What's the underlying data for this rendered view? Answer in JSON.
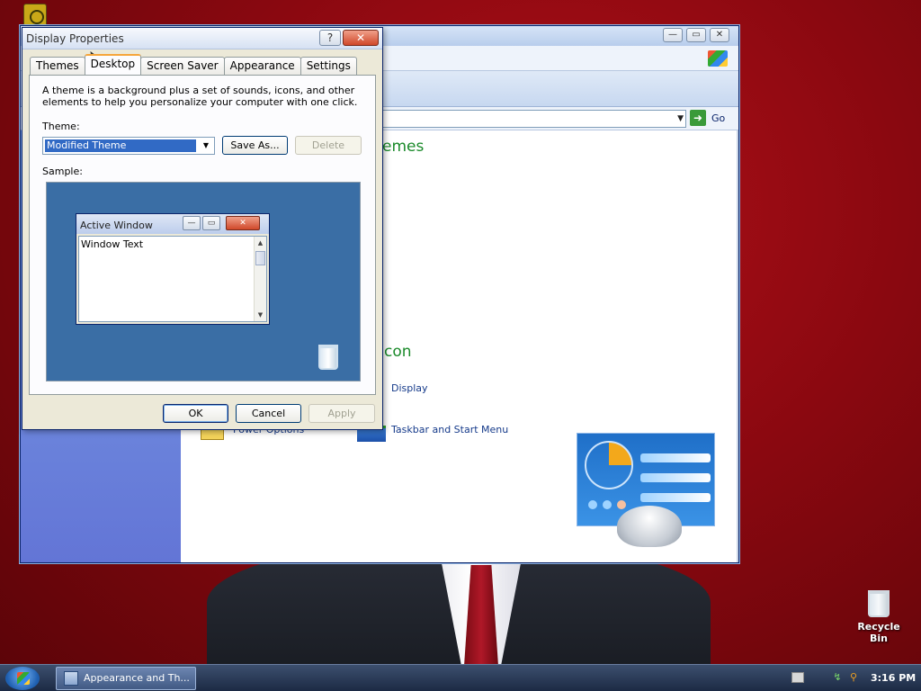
{
  "dialog": {
    "title": "Display Properties",
    "tabs": [
      {
        "label": "Themes"
      },
      {
        "label": "Desktop"
      },
      {
        "label": "Screen Saver"
      },
      {
        "label": "Appearance"
      },
      {
        "label": "Settings"
      }
    ],
    "active_tab": "Desktop",
    "description": "A theme is a background plus a set of sounds, icons, and other elements to help you personalize your computer with one click.",
    "theme_label": "Theme:",
    "theme_value": "Modified Theme",
    "save_as_label": "Save As...",
    "delete_label": "Delete",
    "sample_label": "Sample:",
    "sample": {
      "window_title": "Active Window",
      "window_text": "Window Text"
    },
    "ok_label": "OK",
    "cancel_label": "Cancel",
    "apply_label": "Apply"
  },
  "control_panel": {
    "address_go_label": "Go",
    "heading_themes_partial": "emes",
    "heading_icon_partial": "con",
    "links": {
      "display": "Display",
      "taskbar": "Taskbar and Start Menu",
      "power_partial": "Power Options"
    }
  },
  "desktop": {
    "recycle_bin_label": "Recycle Bin"
  },
  "taskbar": {
    "task_button_label": "Appearance and Th...",
    "clock": "3:16 PM"
  },
  "colors": {
    "desktop_red": "#8a0810",
    "title_blue": "#0a246a",
    "selection_blue": "#316ac5",
    "link_blue": "#153a8a",
    "heading_green": "#1a8a2a"
  }
}
